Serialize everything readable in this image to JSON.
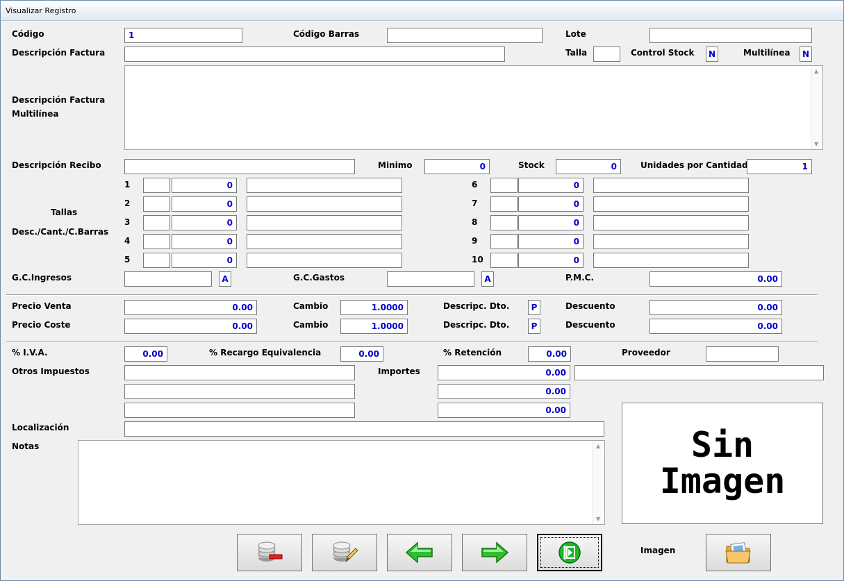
{
  "window": {
    "title": "Visualizar Registro"
  },
  "labels": {
    "codigo": "Código",
    "codigo_barras": "Código Barras",
    "lote": "Lote",
    "desc_factura": "Descripción Factura",
    "talla": "Talla",
    "control_stock": "Control Stock",
    "multilinea": "Multilínea",
    "desc_factura_multi_1": "Descripción Factura",
    "desc_factura_multi_2": "Multilínea",
    "desc_recibo": "Descripción Recibo",
    "minimo": "Minimo",
    "stock": "Stock",
    "unidades_cantidad": "Unidades por Cantidad",
    "tallas_1": "Tallas",
    "tallas_2": "Desc./Cant./C.Barras",
    "gc_ingresos": "G.C.Ingresos",
    "gc_gastos": "G.C.Gastos",
    "pmc": "P.M.C.",
    "precio_venta": "Precio Venta",
    "precio_coste": "Precio Coste",
    "cambio": "Cambio",
    "descripc_dto": "Descripc. Dto.",
    "descuento": "Descuento",
    "iva": "% I.V.A.",
    "recargo": "% Recargo Equivalencia",
    "retencion": "% Retención",
    "proveedor": "Proveedor",
    "otros_impuestos": "Otros Impuestos",
    "importes": "Importes",
    "localizacion": "Localización",
    "notas": "Notas",
    "imagen": "Imagen"
  },
  "values": {
    "codigo": "1",
    "codigo_barras": "",
    "lote": "",
    "desc_factura": "",
    "talla": "",
    "control_stock": "N",
    "multilinea": "N",
    "desc_recibo": "",
    "minimo": "0",
    "stock": "0",
    "unidades_cantidad": "1",
    "gc_ingresos": "",
    "gc_ingresos_flag": "A",
    "gc_gastos": "",
    "gc_gastos_flag": "A",
    "pmc": "0.00",
    "precio_venta": "0.00",
    "cambio_venta": "1.0000",
    "dto_venta_flag": "P",
    "descuento_venta": "0.00",
    "precio_coste": "0.00",
    "cambio_coste": "1.0000",
    "dto_coste_flag": "P",
    "descuento_coste": "0.00",
    "iva": "0.00",
    "recargo": "0.00",
    "retencion": "0.00",
    "proveedor": "",
    "proveedor_nombre": "",
    "otros_impuestos": [
      "",
      "",
      ""
    ],
    "importes": [
      "0.00",
      "0.00",
      "0.00"
    ],
    "localizacion": ""
  },
  "tallas": [
    {
      "num": "1",
      "desc": "",
      "cant": "0",
      "barras": ""
    },
    {
      "num": "2",
      "desc": "",
      "cant": "0",
      "barras": ""
    },
    {
      "num": "3",
      "desc": "",
      "cant": "0",
      "barras": ""
    },
    {
      "num": "4",
      "desc": "",
      "cant": "0",
      "barras": ""
    },
    {
      "num": "5",
      "desc": "",
      "cant": "0",
      "barras": ""
    },
    {
      "num": "6",
      "desc": "",
      "cant": "0",
      "barras": ""
    },
    {
      "num": "7",
      "desc": "",
      "cant": "0",
      "barras": ""
    },
    {
      "num": "8",
      "desc": "",
      "cant": "0",
      "barras": ""
    },
    {
      "num": "9",
      "desc": "",
      "cant": "0",
      "barras": ""
    },
    {
      "num": "10",
      "desc": "",
      "cant": "0",
      "barras": ""
    }
  ],
  "image_panel": {
    "line1": "Sin",
    "line2": "Imagen"
  },
  "buttons": [
    {
      "name": "delete-record-button",
      "icon": "database-delete-icon"
    },
    {
      "name": "edit-record-button",
      "icon": "database-edit-icon"
    },
    {
      "name": "previous-record-button",
      "icon": "arrow-left-icon"
    },
    {
      "name": "next-record-button",
      "icon": "arrow-right-icon"
    },
    {
      "name": "exit-button",
      "icon": "exit-icon"
    },
    {
      "name": "open-image-button",
      "icon": "folder-image-icon"
    }
  ],
  "colors": {
    "value_text": "#0000cc",
    "arrow_green": "#2fbf2f",
    "title_bar": "#dfe7f1"
  }
}
